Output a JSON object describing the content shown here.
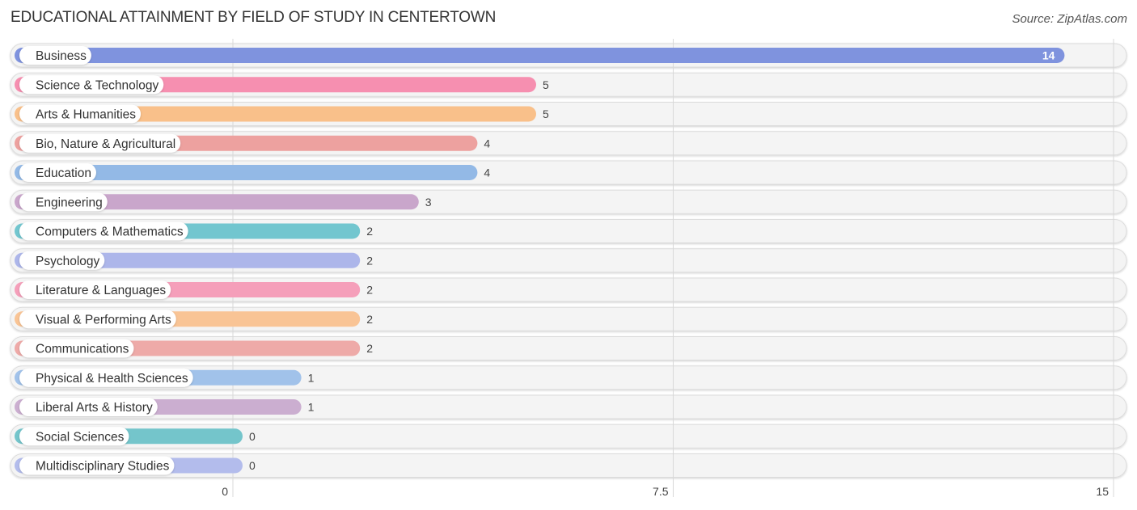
{
  "header": {
    "title": "EDUCATIONAL ATTAINMENT BY FIELD OF STUDY IN CENTERTOWN",
    "source": "Source: ZipAtlas.com"
  },
  "chart_data": {
    "type": "bar",
    "orientation": "horizontal",
    "title": "EDUCATIONAL ATTAINMENT BY FIELD OF STUDY IN CENTERTOWN",
    "xlabel": "",
    "ylabel": "",
    "xlim": [
      0,
      15
    ],
    "x_ticks": [
      "0",
      "7.5",
      "15"
    ],
    "grid": true,
    "categories": [
      "Business",
      "Science & Technology",
      "Arts & Humanities",
      "Bio, Nature & Agricultural",
      "Education",
      "Engineering",
      "Computers & Mathematics",
      "Psychology",
      "Literature & Languages",
      "Visual & Performing Arts",
      "Communications",
      "Physical & Health Sciences",
      "Liberal Arts & History",
      "Social Sciences",
      "Multidisciplinary Studies"
    ],
    "values": [
      14,
      5,
      5,
      4,
      4,
      3,
      2,
      2,
      2,
      2,
      2,
      1,
      1,
      0,
      0
    ],
    "colors": [
      "#7f93de",
      "#f68fb0",
      "#f9c08a",
      "#eda19f",
      "#93b9e6",
      "#c9a6cb",
      "#72c6cf",
      "#adb6ea",
      "#f59fba",
      "#f9c495",
      "#eeaaa8",
      "#a1c2ea",
      "#cbaed0",
      "#74c5cb",
      "#b3bcec"
    ]
  }
}
